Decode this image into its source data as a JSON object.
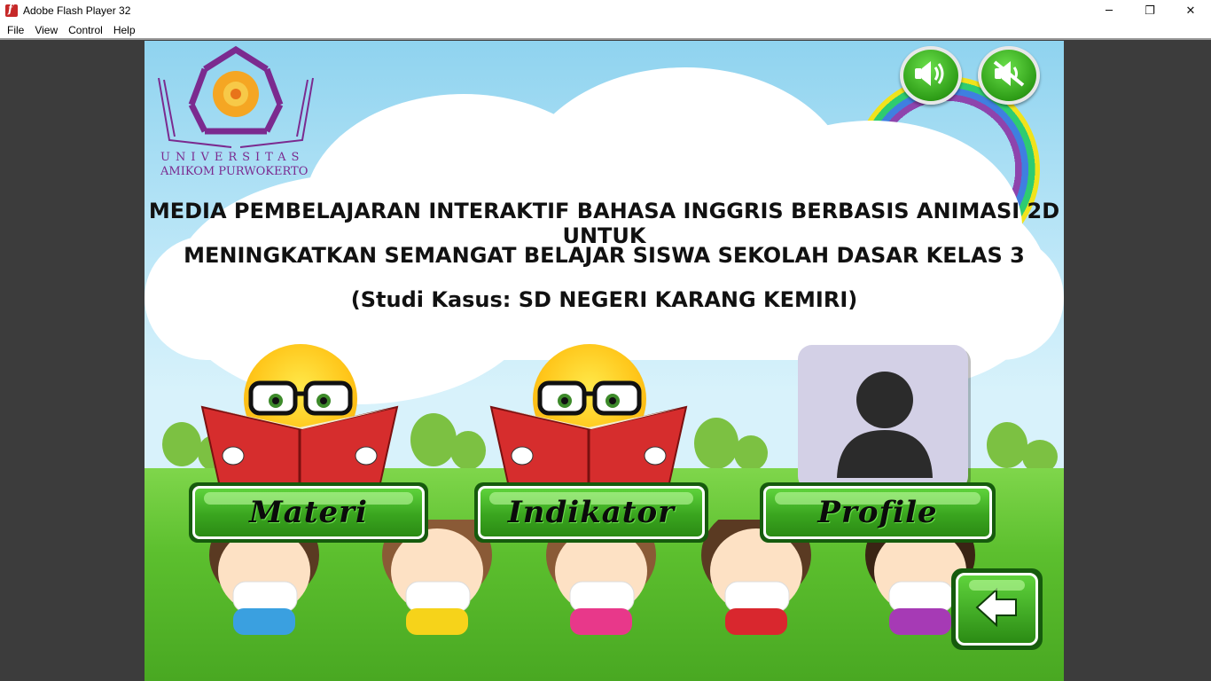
{
  "window": {
    "title": "Adobe Flash Player 32",
    "minimize": "─",
    "maximize": "❐",
    "close": "✕"
  },
  "menubar": {
    "items": [
      "File",
      "View",
      "Control",
      "Help"
    ]
  },
  "logo": {
    "line1": "UNIVERSITAS",
    "line2": "AMIKOM PURWOKERTO"
  },
  "title": {
    "line1": "MEDIA PEMBELAJARAN INTERAKTIF BAHASA INGGRIS BERBASIS ANIMASI 2D UNTUK",
    "line2": "MENINGKATKAN SEMANGAT BELAJAR SISWA SEKOLAH DASAR KELAS 3",
    "line3": "(Studi Kasus: SD NEGERI KARANG KEMIRI)"
  },
  "buttons": {
    "materi": "Materi",
    "indikator": "Indikator",
    "profile": "Profile"
  },
  "icons": {
    "sound_on": "speaker-on-icon",
    "sound_off": "speaker-mute-icon",
    "back": "arrow-left-icon",
    "profile": "person-icon"
  },
  "colors": {
    "button_green": "#3aa51f",
    "button_border": "#165b0d",
    "title_text": "#111111",
    "logo_purple": "#7b2a8f"
  }
}
